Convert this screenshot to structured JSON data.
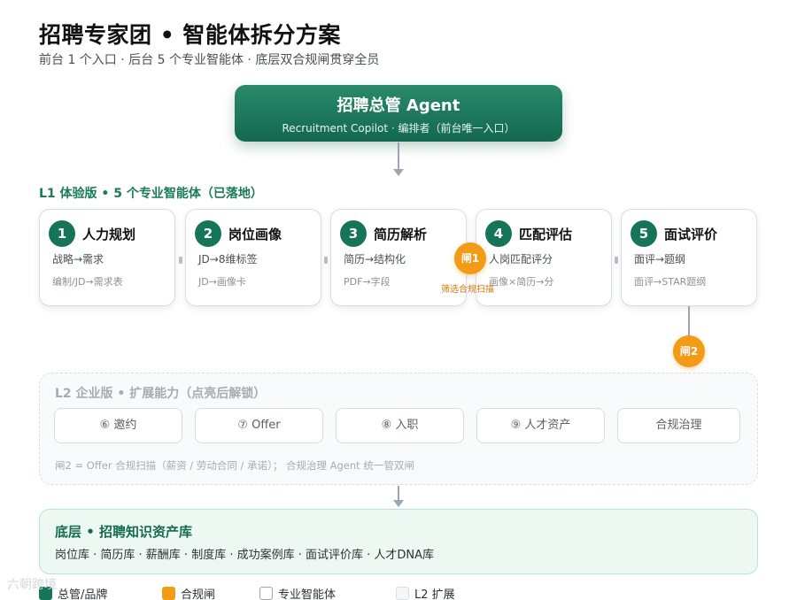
{
  "header": {
    "title": "招聘专家团 • 智能体拆分方案",
    "subtitle": "前台 1 个入口 · 后台 5 个专业智能体 · 底层双合规闸贯穿全员"
  },
  "hub": {
    "title": "招聘总管 Agent",
    "subtitle": "Recruitment Copilot · 编排者（前台唯一入口）"
  },
  "l1": {
    "title": "L1 体验版 • 5 个专业智能体（已落地）",
    "cards": [
      {
        "num": "1",
        "title": "人力规划",
        "line1": "战略→需求",
        "line2": "编制/JD→需求表"
      },
      {
        "num": "2",
        "title": "岗位画像",
        "line1": "JD→8维标签",
        "line2": "JD→画像卡"
      },
      {
        "num": "3",
        "title": "简历解析",
        "line1": "简历→结构化",
        "line2": "PDF→字段"
      },
      {
        "num": "4",
        "title": "匹配评估",
        "line1": "人岗匹配评分",
        "line2": "画像×简历→分"
      },
      {
        "num": "5",
        "title": "面试评价",
        "line1": "面评→题纲",
        "line2": "面评→STAR题纲"
      }
    ]
  },
  "gates": {
    "gate1": "闸1",
    "gate1_caption": "筛选合规扫描",
    "gate2": "闸2"
  },
  "l2": {
    "title": "L2 企业版 • 扩展能力（点亮后解锁）",
    "items": [
      "⑥ 邀约",
      "⑦ Offer",
      "⑧ 入职",
      "⑨ 人才资产",
      "合规治理"
    ],
    "note": "闸2 = Offer 合规扫描（薪资 / 劳动合同 / 承诺）； 合规治理 Agent 统一管双闸"
  },
  "base": {
    "title": "底层 • 招聘知识资产库",
    "items": "岗位库 · 简历库 · 薪酬库 · 制度库 · 成功案例库 · 面试评价库 · 人才DNA库"
  },
  "legend": {
    "items": [
      "总管/品牌",
      "合规闸",
      "专业智能体",
      "L2 扩展"
    ]
  },
  "watermark": "六朝跨境",
  "colors": {
    "brand_green": "#157556",
    "gate_orange": "#f39a16",
    "base_bg": "#eef8f3"
  }
}
